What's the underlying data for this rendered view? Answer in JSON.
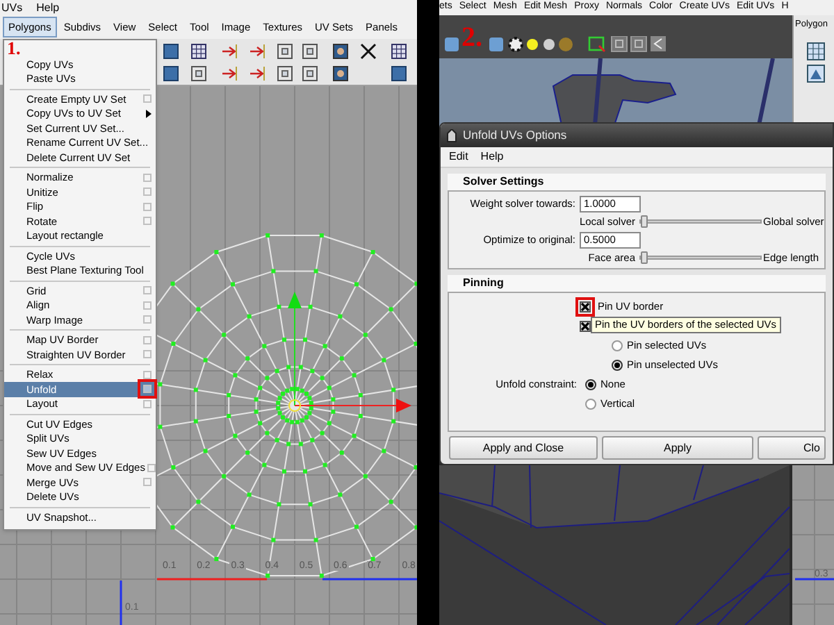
{
  "left": {
    "top_menu": [
      "UVs",
      "Help"
    ],
    "menu_bar": [
      {
        "label": "Polygons",
        "selected": true
      },
      {
        "label": "Subdivs",
        "selected": false
      },
      {
        "label": "View",
        "selected": false
      },
      {
        "label": "Select",
        "selected": false
      },
      {
        "label": "Tool",
        "selected": false
      },
      {
        "label": "Image",
        "selected": false
      },
      {
        "label": "Textures",
        "selected": false
      },
      {
        "label": "UV Sets",
        "selected": false
      },
      {
        "label": "Panels",
        "selected": false
      }
    ],
    "step_marker": "1.",
    "dropdown": {
      "groups": [
        {
          "items": [
            {
              "label": "Copy UVs",
              "kind": "plain",
              "selected": false
            },
            {
              "label": "Paste UVs",
              "kind": "plain",
              "selected": false
            }
          ]
        },
        {
          "items": [
            {
              "label": "Create Empty UV Set",
              "kind": "option",
              "selected": false,
              "marked": false
            },
            {
              "label": "Copy UVs to UV Set",
              "kind": "submenu",
              "selected": false
            },
            {
              "label": "Set Current UV Set...",
              "kind": "plain",
              "selected": false
            },
            {
              "label": "Rename Current UV Set...",
              "kind": "plain",
              "selected": false
            },
            {
              "label": "Delete Current UV Set",
              "kind": "plain",
              "selected": false
            }
          ]
        },
        {
          "items": [
            {
              "label": "Normalize",
              "kind": "option",
              "selected": false,
              "marked": false
            },
            {
              "label": "Unitize",
              "kind": "option",
              "selected": false,
              "marked": false
            },
            {
              "label": "Flip",
              "kind": "option",
              "selected": false,
              "marked": false
            },
            {
              "label": "Rotate",
              "kind": "option",
              "selected": false,
              "marked": false
            },
            {
              "label": "Layout rectangle",
              "kind": "plain",
              "selected": false
            }
          ]
        },
        {
          "items": [
            {
              "label": "Cycle UVs",
              "kind": "plain",
              "selected": false
            },
            {
              "label": "Best Plane Texturing Tool",
              "kind": "plain",
              "selected": false
            }
          ]
        },
        {
          "items": [
            {
              "label": "Grid",
              "kind": "option",
              "selected": false,
              "marked": false
            },
            {
              "label": "Align",
              "kind": "option",
              "selected": false,
              "marked": false
            },
            {
              "label": "Warp Image",
              "kind": "option",
              "selected": false,
              "marked": false
            }
          ]
        },
        {
          "items": [
            {
              "label": "Map UV Border",
              "kind": "option",
              "selected": false,
              "marked": false
            },
            {
              "label": "Straighten UV Border",
              "kind": "option",
              "selected": false,
              "marked": false
            }
          ]
        },
        {
          "items": [
            {
              "label": "Relax",
              "kind": "option",
              "selected": false,
              "marked": false
            },
            {
              "label": "Unfold",
              "kind": "option",
              "selected": true,
              "marked": true
            },
            {
              "label": "Layout",
              "kind": "option",
              "selected": false,
              "marked": false
            }
          ]
        },
        {
          "items": [
            {
              "label": "Cut UV Edges",
              "kind": "plain",
              "selected": false
            },
            {
              "label": "Split UVs",
              "kind": "plain",
              "selected": false
            },
            {
              "label": "Sew UV Edges",
              "kind": "plain",
              "selected": false
            },
            {
              "label": "Move and Sew UV Edges",
              "kind": "option",
              "selected": false,
              "marked": false
            },
            {
              "label": "Merge UVs",
              "kind": "option",
              "selected": false,
              "marked": false
            },
            {
              "label": "Delete UVs",
              "kind": "plain",
              "selected": false
            }
          ]
        },
        {
          "items": [
            {
              "label": "UV Snapshot...",
              "kind": "plain",
              "selected": false
            }
          ]
        }
      ]
    },
    "u_ticks": [
      "0.1",
      "0.2",
      "0.3",
      "0.4",
      "0.5",
      "0.6",
      "0.7",
      "0.8"
    ],
    "v_ticks": [
      "0.1"
    ]
  },
  "right": {
    "menu_bar": [
      "ets",
      "Select",
      "Mesh",
      "Edit Mesh",
      "Proxy",
      "Normals",
      "Color",
      "Create UVs",
      "Edit UVs",
      "H"
    ],
    "step_marker": "2.",
    "side_panel_title": "Polygon",
    "dialog": {
      "title": "Unfold UVs Options",
      "menus": [
        "Edit",
        "Help"
      ],
      "solver": {
        "title": "Solver Settings",
        "rows": [
          {
            "label": "Weight solver towards:",
            "value": "1.0000",
            "min_label": "Local solver",
            "max_label": "Global solver",
            "level": 0
          },
          {
            "label": "Optimize to original:",
            "value": "0.5000",
            "min_label": "Face area",
            "max_label": "Edge length",
            "level": 0
          }
        ]
      },
      "pinning": {
        "title": "Pinning",
        "checkboxes": [
          {
            "label": "Pin UV border",
            "checked": true,
            "marked": true
          },
          {
            "checked": true,
            "marked": false
          }
        ],
        "tooltip": "Pin the UV borders of the selected UVs",
        "pin_options": [
          {
            "label": "Pin selected UVs",
            "selected": false
          },
          {
            "label": "Pin unselected UVs",
            "selected": true
          }
        ],
        "constraint": {
          "label": "Unfold constraint:",
          "options": [
            {
              "label": "None",
              "selected": true
            },
            {
              "label": "Vertical",
              "selected": false
            }
          ]
        }
      },
      "buttons": [
        "Apply and Close",
        "Apply",
        "Clo"
      ]
    },
    "grid_tick": "0.3"
  }
}
